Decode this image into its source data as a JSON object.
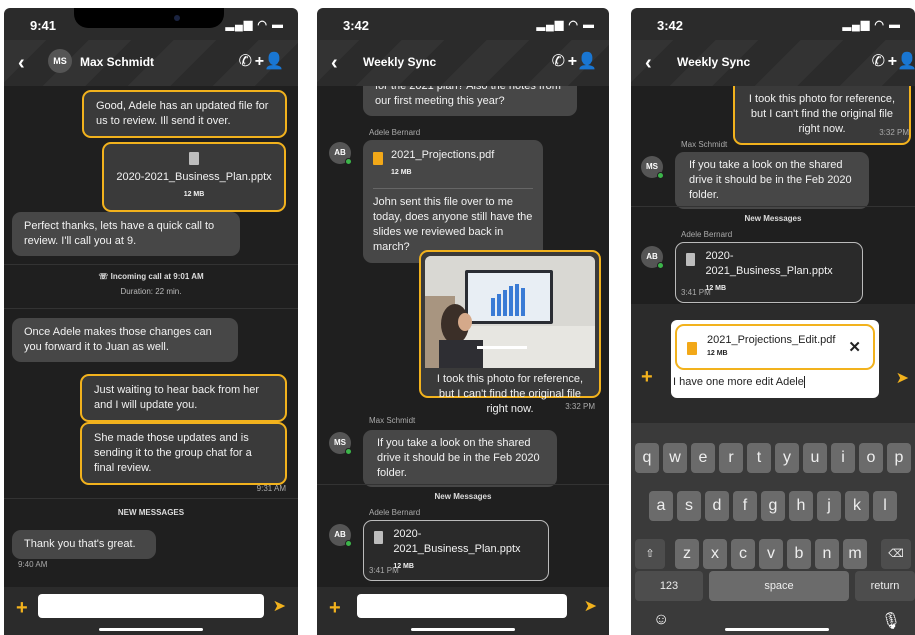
{
  "screen1": {
    "status_time": "9:41",
    "header_initials": "MS",
    "header_title": "Max Schmidt",
    "msg1": "Good, Adele has an updated file for us to review. Ill send it over.",
    "file1_name": "2020-2021_Business_Plan.pptx",
    "file1_size": "12 MB",
    "msg2": "Perfect thanks, lets have a quick call to review. I'll call you at 9.",
    "call_label": "Incoming call at 9:01 AM",
    "call_duration": "Duration: 22 min.",
    "msg3": "Once Adele makes those changes can you forward it to Juan as well.",
    "msg4": "Just waiting to hear back from her and I will update you.",
    "msg5": "She made those updates and is sending it to the group chat for a final review.",
    "time1": "9:31 AM",
    "new_messages": "NEW MESSAGES",
    "msg6": "Thank you that's great.",
    "time2": "9:40 AM"
  },
  "screen2": {
    "status_time": "3:42",
    "header_title": "Weekly Sync",
    "msg_top": "for the 2021 plan? Also the notes from our first meeting this year?",
    "sender1": "Adele Bernard",
    "avatar1": "AB",
    "file_name": "2021_Projections.pdf",
    "file_size": "12 MB",
    "msg_file_text": "John sent this file over to me today, does anyone still have the slides we reviewed back in march?",
    "photo_caption": "I took this photo for reference, but I can't find the original file right now.",
    "time1": "3:32 PM",
    "sender2": "Max Schmidt",
    "avatar2": "MS",
    "msg_ms": "If you take a look on the shared drive it should be in the Feb 2020 folder.",
    "new_messages": "New Messages",
    "sender3": "Adele Bernard",
    "avatar3": "AB",
    "file2_name": "2020-2021_Business_Plan.pptx",
    "file2_size": "12 MB",
    "time2": "3:41 PM"
  },
  "screen3": {
    "status_time": "3:42",
    "header_title": "Weekly Sync",
    "photo_caption": "I took this photo for reference, but I can't find the original file right now.",
    "time1": "3:32 PM",
    "sender1": "Max Schmidt",
    "avatar1": "MS",
    "msg_ms": "If you take a look on the shared drive it should be in the Feb 2020 folder.",
    "new_messages": "New Messages",
    "sender2": "Adele Bernard",
    "avatar2": "AB",
    "file_name": "2020-2021_Business_Plan.pptx",
    "file_size": "12 MB",
    "time2": "3:41 PM",
    "attach_name": "2021_Projections_Edit.pdf",
    "attach_size": "12 MB",
    "input_text": "I have one more edit Adele",
    "keys_row1": [
      "q",
      "w",
      "e",
      "r",
      "t",
      "y",
      "u",
      "i",
      "o",
      "p"
    ],
    "keys_row2": [
      "a",
      "s",
      "d",
      "f",
      "g",
      "h",
      "j",
      "k",
      "l"
    ],
    "keys_row3": [
      "z",
      "x",
      "c",
      "v",
      "b",
      "n",
      "m"
    ],
    "key_numbers": "123",
    "key_space": "space",
    "key_return": "return"
  },
  "colors": {
    "accent": "#f2b21d",
    "bubble": "#474747",
    "background": "#1f1f1f",
    "online": "#3cb54a"
  },
  "icons": [
    "back-arrow-icon",
    "phone-icon",
    "add-user-icon",
    "document-icon",
    "pdf-icon",
    "plus-icon",
    "send-icon",
    "incoming-call-icon",
    "close-icon",
    "shift-icon",
    "backspace-icon",
    "emoji-icon",
    "microphone-icon"
  ]
}
